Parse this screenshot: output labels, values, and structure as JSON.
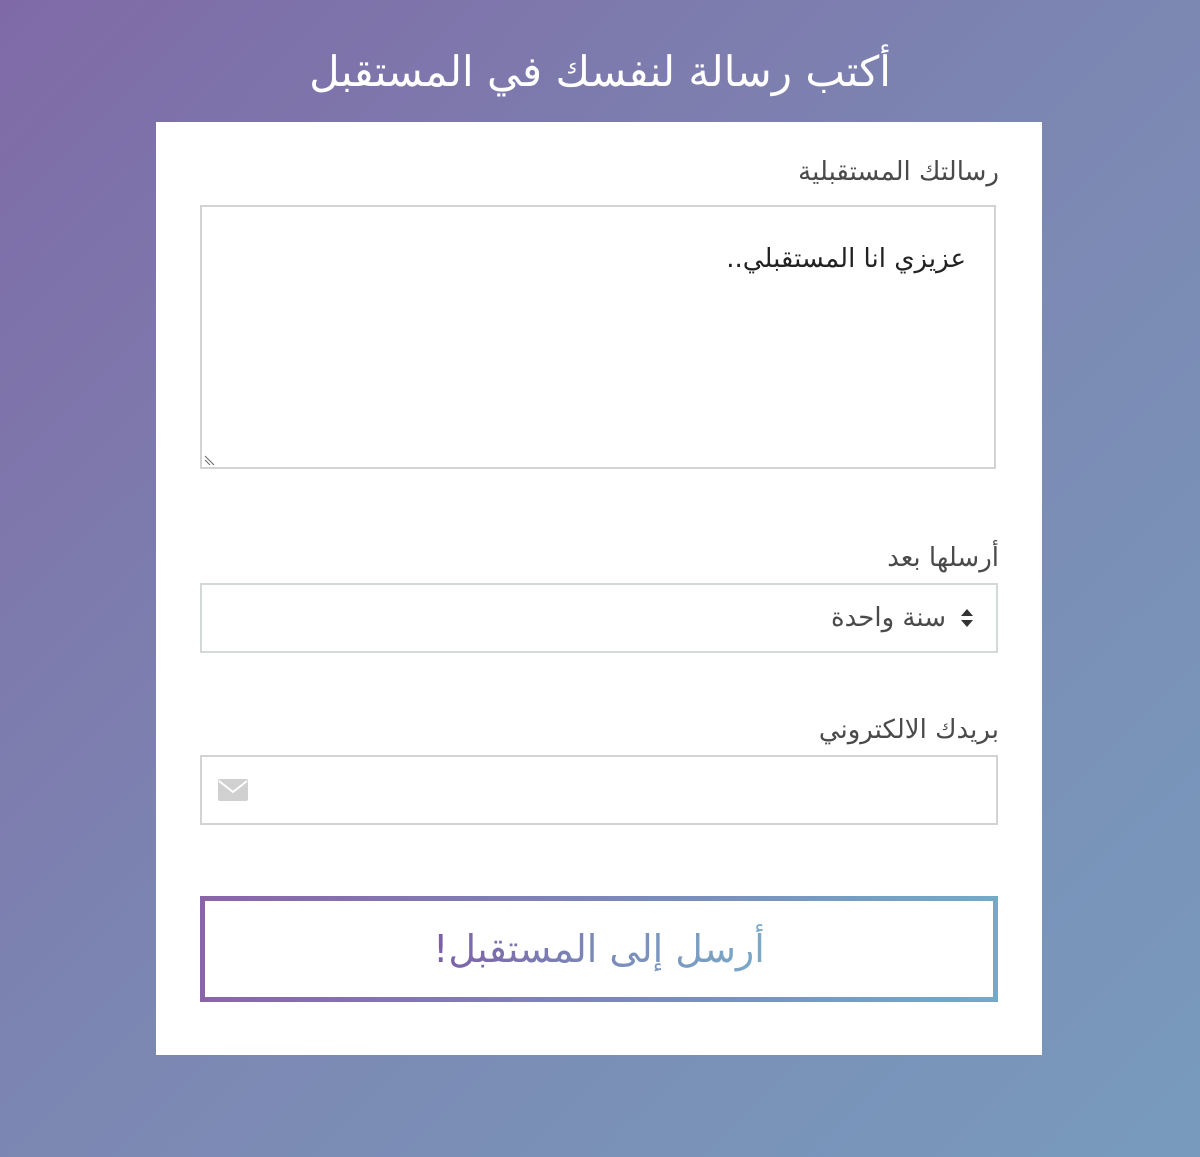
{
  "page": {
    "title": "أكتب رسالة لنفسك في المستقبل"
  },
  "form": {
    "message": {
      "label": "رسالتك المستقبلية",
      "value": "عزيزي انا المستقبلي.."
    },
    "send_after": {
      "label": "أرسلها بعد",
      "selected": "سنة واحدة"
    },
    "email": {
      "label": "بريدك الالكتروني",
      "value": "",
      "icon": "envelope-icon"
    },
    "submit_label": "أرسل إلى المستقبل!"
  },
  "colors": {
    "background_start": "#7f6aa7",
    "background_end": "#789bbd",
    "button_gradient_start": "#8a64a8",
    "button_gradient_end": "#73aac6"
  }
}
